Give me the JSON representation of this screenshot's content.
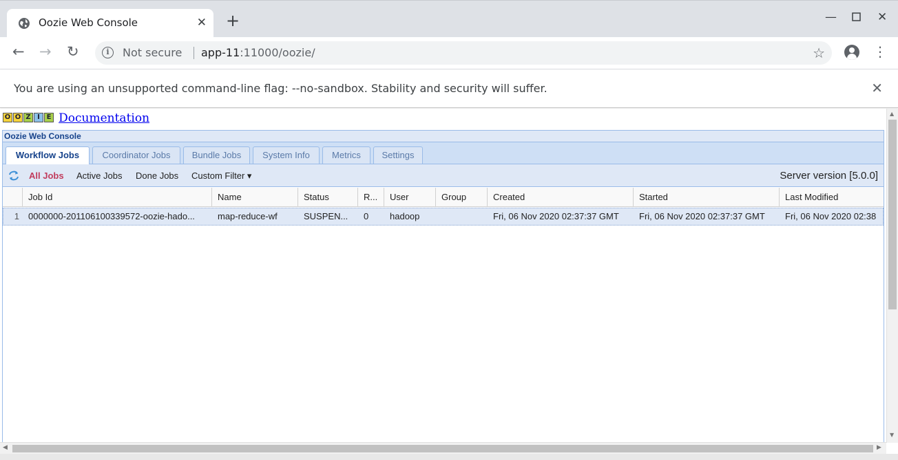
{
  "browser": {
    "tab_title": "Oozie Web Console",
    "new_tab_symbol": "+",
    "address": {
      "security_label": "Not secure",
      "host": "app-11",
      "rest": ":11000/oozie/"
    }
  },
  "infobar": {
    "message": "You are using an unsupported command-line flag: --no-sandbox. Stability and security will suffer."
  },
  "page": {
    "logo_letters": [
      "O",
      "O",
      "Z",
      "I",
      "E"
    ],
    "documentation_link": "Documentation",
    "console_title": "Oozie Web Console",
    "tabs": [
      {
        "label": "Workflow Jobs",
        "active": true
      },
      {
        "label": "Coordinator Jobs",
        "active": false
      },
      {
        "label": "Bundle Jobs",
        "active": false
      },
      {
        "label": "System Info",
        "active": false
      },
      {
        "label": "Metrics",
        "active": false
      },
      {
        "label": "Settings",
        "active": false
      }
    ],
    "toolbar": {
      "all_jobs": "All Jobs",
      "active_jobs": "Active Jobs",
      "done_jobs": "Done Jobs",
      "custom_filter": "Custom Filter ▾",
      "server_version": "Server version [5.0.0]"
    },
    "grid": {
      "columns": [
        "Job Id",
        "Name",
        "Status",
        "R...",
        "User",
        "Group",
        "Created",
        "Started",
        "Last Modified"
      ],
      "rows": [
        {
          "num": "1",
          "job_id": "0000000-201106100339572-oozie-hado...",
          "name": "map-reduce-wf",
          "status": "SUSPEN...",
          "run": "0",
          "user": "hadoop",
          "group": "",
          "created": "Fri, 06 Nov 2020 02:37:37 GMT",
          "started": "Fri, 06 Nov 2020 02:37:37 GMT",
          "last_modified": "Fri, 06 Nov 2020 02:38"
        }
      ]
    }
  },
  "colors": {
    "chrome_bg": "#dee1e6",
    "ext_border": "#99bbe8",
    "ext_header": "#dfe8f6",
    "ext_title": "#15428b",
    "selected_filter": "#c13b5c"
  }
}
